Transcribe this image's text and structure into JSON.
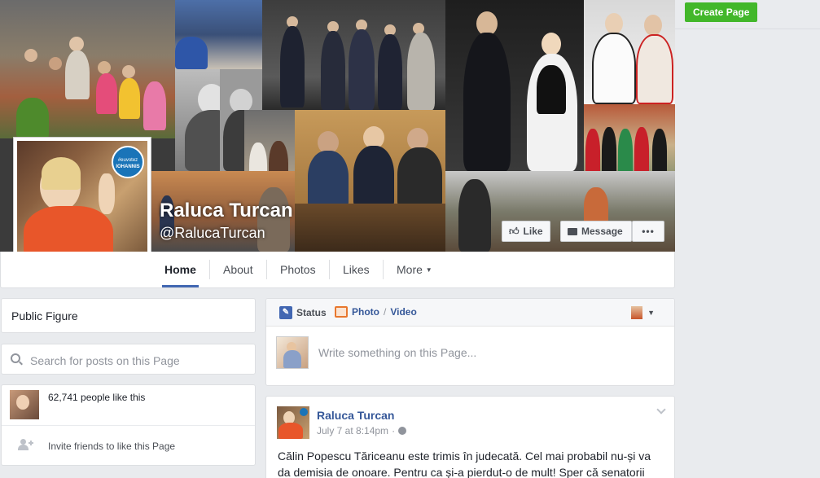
{
  "header": {
    "create_page_label": "Create Page"
  },
  "page": {
    "name": "Raluca Turcan",
    "handle": "@RalucaTurcan",
    "badge_line1": "#euvotez",
    "badge_line2": "IOHANNIS"
  },
  "cover_actions": {
    "like_label": "Like",
    "message_label": "Message",
    "more_label": "•••"
  },
  "nav": {
    "tabs": [
      {
        "label": "Home"
      },
      {
        "label": "About"
      },
      {
        "label": "Photos"
      },
      {
        "label": "Likes"
      },
      {
        "label": "More"
      }
    ]
  },
  "left": {
    "category": "Public Figure",
    "search_placeholder": "Search for posts on this Page",
    "likes_text": "62,741 people like this",
    "invite_text": "Invite friends to like this Page"
  },
  "composer": {
    "status_label": "Status",
    "photo_label": "Photo",
    "video_label": "Video",
    "divider": "/",
    "placeholder": "Write something on this Page..."
  },
  "post": {
    "author": "Raluca Turcan",
    "timestamp": "July 7 at 8:14pm",
    "separator": "·",
    "text_line1": "Călin Popescu Tăriceanu este trimis în judecată. Cel mai probabil nu-și va",
    "text_line2": "da demisia de onoare. Pentru ca și-a pierdut-o de mult! Sper că senatorii"
  },
  "colors": {
    "accent": "#4267b2",
    "link": "#365899",
    "green": "#42b72a"
  }
}
